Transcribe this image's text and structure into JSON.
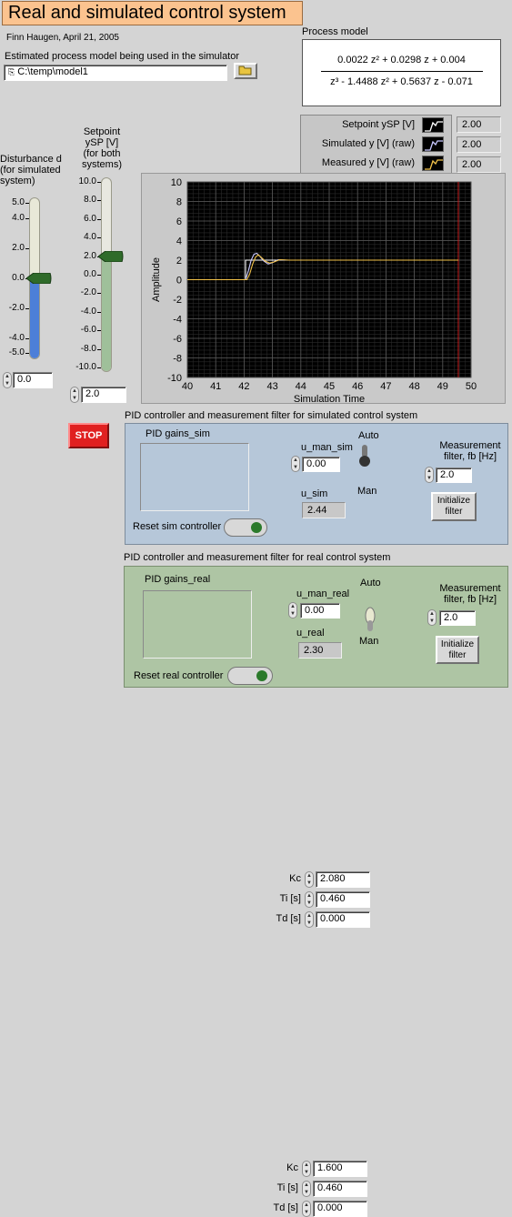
{
  "title": "Real and simulated control system",
  "author": "Finn Haugen, April 21, 2005",
  "model_path": {
    "label": "Estimated process model being used in the simulator",
    "value": "C:\\temp\\model1",
    "browse_icon": "folder-open-icon"
  },
  "process_model": {
    "label": "Process model",
    "numerator": "0.0022 z² + 0.0298 z + 0.004",
    "denominator": "z³ - 1.4488 z² + 0.5637 z - 0.071"
  },
  "legend": {
    "items": [
      {
        "label": "Setpoint ySP [V]",
        "value": "2.00",
        "color": "#ffffff"
      },
      {
        "label": "Simulated y [V] (raw)",
        "value": "2.00",
        "color": "#c8c8ff"
      },
      {
        "label": "Measured y [V] (raw)",
        "value": "2.00",
        "color": "#f2c24a"
      }
    ]
  },
  "disturbance": {
    "label": "Disturbance d (for simulated system)",
    "ticks": [
      "5.0",
      "4.0",
      "2.0",
      "0.0",
      "-2.0",
      "-4.0",
      "-5.0"
    ],
    "value": "0.0",
    "level": 0.0,
    "min": -5,
    "max": 5
  },
  "setpoint": {
    "label": "Setpoint ySP [V] (for both systems)",
    "ticks": [
      "10.0",
      "8.0",
      "6.0",
      "4.0",
      "2.0",
      "0.0",
      "-2.0",
      "-4.0",
      "-6.0",
      "-8.0",
      "-10.0"
    ],
    "value": "2.0",
    "level": 2.0,
    "min": -10,
    "max": 10
  },
  "chart_data": {
    "type": "line",
    "xlabel": "Simulation Time",
    "ylabel": "Amplitude",
    "xlim": [
      40,
      50
    ],
    "ylim": [
      -10,
      10
    ],
    "xticks": [
      "40",
      "41",
      "42",
      "43",
      "44",
      "45",
      "46",
      "47",
      "48",
      "49",
      "50"
    ],
    "yticks": [
      "10",
      "8",
      "6",
      "4",
      "2",
      "0",
      "-2",
      "-4",
      "-6",
      "-8",
      "-10"
    ],
    "grid": true,
    "cursor_x": 49.55,
    "series": [
      {
        "name": "Setpoint ySP [V]",
        "color": "#ffffff",
        "x": [
          40,
          42.05,
          42.05,
          49.55
        ],
        "y": [
          0,
          0,
          2,
          2
        ]
      },
      {
        "name": "Simulated y [V] (raw)",
        "color": "#c8c8ff",
        "x": [
          40,
          42.05,
          42.15,
          42.25,
          42.35,
          42.45,
          42.55,
          42.7,
          42.85,
          43.0,
          43.2,
          43.5,
          49.55
        ],
        "y": [
          0,
          0,
          0.9,
          2.0,
          2.6,
          2.7,
          2.4,
          1.9,
          1.6,
          1.75,
          2.05,
          2.0,
          2.0
        ]
      },
      {
        "name": "Measured y [V] (raw)",
        "color": "#f2c24a",
        "x": [
          40,
          42.1,
          42.2,
          42.3,
          42.4,
          42.5,
          42.6,
          42.75,
          42.9,
          43.05,
          43.25,
          43.6,
          49.55
        ],
        "y": [
          0,
          0,
          0.6,
          1.6,
          2.3,
          2.55,
          2.3,
          1.9,
          1.7,
          1.8,
          2.05,
          2.0,
          2.0
        ]
      }
    ]
  },
  "stop_button": "STOP",
  "sim": {
    "header": "PID controller and measurement filter for simulated control system",
    "gains_title": "PID gains_sim",
    "gains": [
      {
        "label": "Kc",
        "value": "2.080"
      },
      {
        "label": "Ti [s]",
        "value": "0.460"
      },
      {
        "label": "Td [s]",
        "value": "0.000"
      }
    ],
    "reset_label": "Reset sim controller",
    "u_man_label": "u_man_sim",
    "u_man_value": "0.00",
    "u_label": "u_sim",
    "u_value": "2.44",
    "auto_label": "Auto",
    "man_label": "Man",
    "filter_label": "Measurement filter, fb [Hz]",
    "filter_value": "2.0",
    "init_label": "Initialize filter"
  },
  "real": {
    "header": "PID controller and measurement filter for real control system",
    "gains_title": "PID gains_real",
    "gains": [
      {
        "label": "Kc",
        "value": "1.600"
      },
      {
        "label": "Ti [s]",
        "value": "0.460"
      },
      {
        "label": "Td [s]",
        "value": "0.000"
      }
    ],
    "reset_label": "Reset real controller",
    "u_man_label": "u_man_real",
    "u_man_value": "0.00",
    "u_label": "u_real",
    "u_value": "2.30",
    "auto_label": "Auto",
    "man_label": "Man",
    "filter_label": "Measurement filter, fb [Hz]",
    "filter_value": "2.0",
    "init_label": "Initialize filter"
  }
}
